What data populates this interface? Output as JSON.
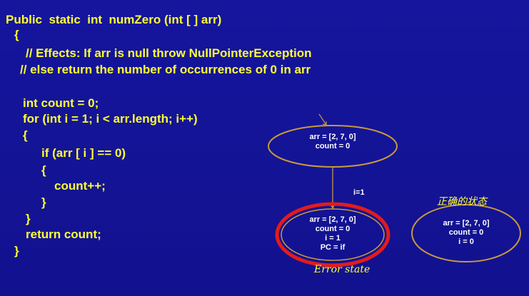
{
  "code": {
    "lines": [
      "Public  static  int  numZero (int [ ] arr)",
      "{",
      "// Effects: If arr is null throw NullPointerException",
      "// else return the number of occurrences of 0 in arr",
      "int count = 0;",
      "for (int i = 1; i < arr.length; i++)",
      "{",
      "if (arr [ i ] == 0)",
      "{",
      "count++;",
      "}",
      "}",
      "return count;",
      "}"
    ]
  },
  "states": {
    "initial": {
      "lines": [
        "arr = [2, 7, 0]",
        "count = 0"
      ]
    },
    "error": {
      "lines": [
        "arr = [2, 7, 0]",
        "count = 0",
        "i = 1",
        "PC = if"
      ]
    },
    "correct": {
      "lines": [
        "arr = [2, 7, 0]",
        "count = 0",
        "i = 0"
      ]
    }
  },
  "edge_label": "i=1",
  "annotations": {
    "error_state": "Error state",
    "correct_state": "正确的状态"
  },
  "colors": {
    "background": "#13139a",
    "code_text": "#ffff33",
    "state_border": "#c89a3a",
    "error_highlight": "#e31b1b",
    "arrow": "#c89a3a"
  }
}
